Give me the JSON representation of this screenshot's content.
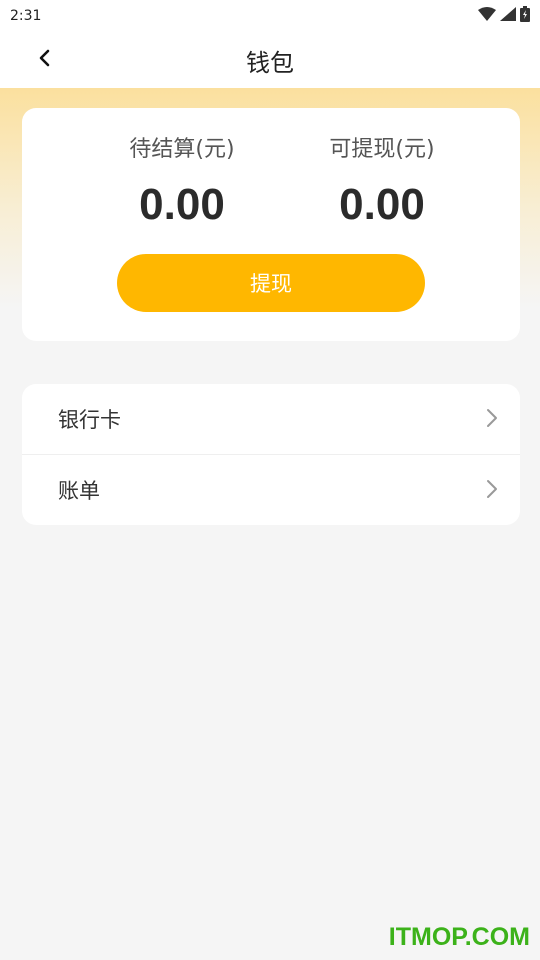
{
  "status_bar": {
    "time": "2:31"
  },
  "header": {
    "title": "钱包"
  },
  "balance": {
    "pending_label": "待结算(元)",
    "pending_value": "0.00",
    "withdrawable_label": "可提现(元)",
    "withdrawable_value": "0.00",
    "withdraw_button": "提现"
  },
  "menu": {
    "items": [
      {
        "label": "银行卡",
        "icon": "chevron-right-icon"
      },
      {
        "label": "账单",
        "icon": "chevron-right-icon"
      }
    ]
  },
  "watermark": "ITMOP.COM",
  "colors": {
    "accent": "#ffb700",
    "header_gradient_top": "#fbe09e",
    "background": "#f5f5f5",
    "watermark": "#3cb21a"
  }
}
